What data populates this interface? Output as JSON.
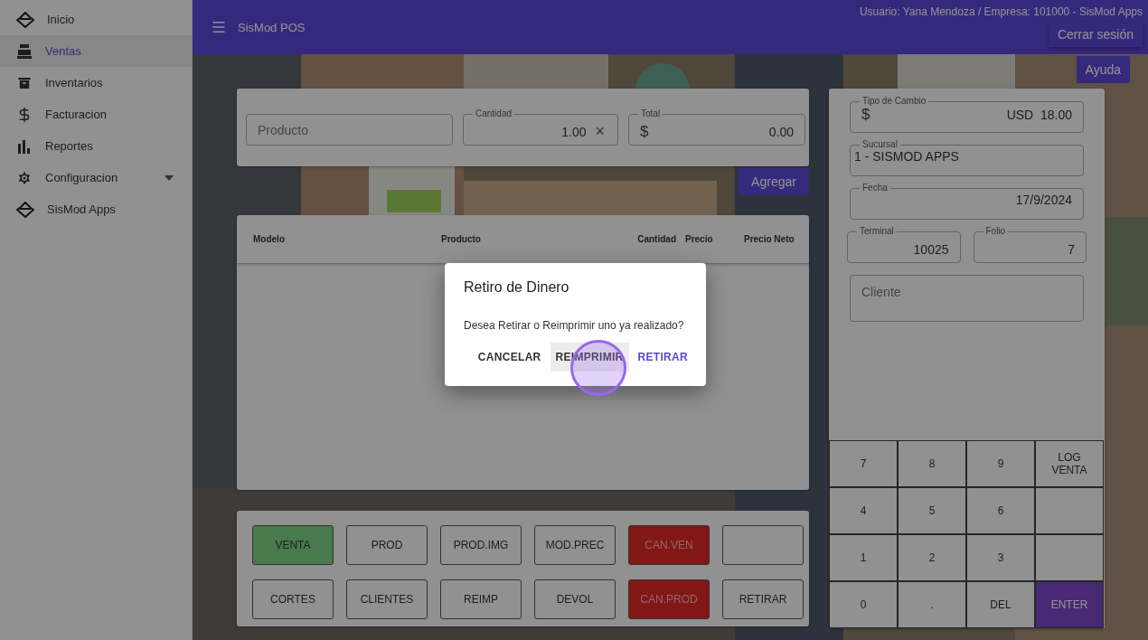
{
  "sidebar": {
    "items": [
      {
        "label": "Inicio",
        "selected": false
      },
      {
        "label": "Ventas",
        "selected": true
      },
      {
        "label": "Inventarios",
        "selected": false
      },
      {
        "label": "Facturacion",
        "selected": false
      },
      {
        "label": "Reportes",
        "selected": false
      },
      {
        "label": "Configuracion",
        "selected": false,
        "expanded": false
      },
      {
        "label": "SisMod Apps",
        "selected": false
      }
    ]
  },
  "topbar": {
    "title": "SisMod POS",
    "user": "Usuario: Yana Mendoza / Empresa: 101000 - SisMod Apps",
    "logout": "Cerrar sesión"
  },
  "help_button": "Ayuda",
  "entry": {
    "product": {
      "placeholder": "Producto"
    },
    "quantity": {
      "label": "Cantidad",
      "value": "1.00",
      "clear": "×"
    },
    "total": {
      "label": "Total",
      "prefix": "$",
      "value": "0.00"
    },
    "add_button": "Agregar"
  },
  "table": {
    "columns": [
      "Modelo",
      "Producto",
      "Cantidad",
      "Precio",
      "Precio Neto"
    ]
  },
  "form": {
    "exchange": {
      "label": "Tipo de Cambio",
      "prefix": "$",
      "value": "USD  18.00"
    },
    "branch": {
      "label": "Sucursal",
      "value": "1 - SISMOD APPS"
    },
    "date": {
      "label": "Fecha",
      "value": "17/9/2024"
    },
    "terminal": {
      "label": "Terminal",
      "value": "10025"
    },
    "folio": {
      "label": "Folio",
      "value": "7"
    },
    "client": {
      "placeholder": "Cliente"
    }
  },
  "actions": [
    {
      "label": "VENTA",
      "kind": "success"
    },
    {
      "label": "PROD",
      "kind": "plain"
    },
    {
      "label": "PROD.IMG",
      "kind": "plain"
    },
    {
      "label": "MOD.PREC",
      "kind": "plain"
    },
    {
      "label": "CAN.VEN",
      "kind": "danger"
    },
    {
      "kind": "plain"
    },
    {
      "label": "CORTES",
      "kind": "plain"
    },
    {
      "label": "CLIENTES",
      "kind": "plain"
    },
    {
      "label": "REIMP",
      "kind": "plain"
    },
    {
      "label": "DEVOL",
      "kind": "plain"
    },
    {
      "label": "CAN.PROD",
      "kind": "danger"
    },
    {
      "label": "RETIRAR",
      "kind": "plain"
    }
  ],
  "keypad": [
    {
      "label": "7",
      "kind": "plain"
    },
    {
      "label": "8",
      "kind": "plain"
    },
    {
      "label": "9",
      "kind": "plain"
    },
    {
      "label": "LOG VENTA",
      "kind": "plain"
    },
    {
      "label": "4",
      "kind": "plain"
    },
    {
      "label": "5",
      "kind": "plain"
    },
    {
      "label": "6",
      "kind": "plain"
    },
    {
      "kind": "plain"
    },
    {
      "label": "1",
      "kind": "plain"
    },
    {
      "label": "2",
      "kind": "plain"
    },
    {
      "label": "3",
      "kind": "plain"
    },
    {
      "kind": "plain"
    },
    {
      "label": "0",
      "kind": "plain"
    },
    {
      "label": ".",
      "kind": "plain"
    },
    {
      "label": "DEL",
      "kind": "plain"
    },
    {
      "label": "ENTER",
      "kind": "primary"
    }
  ],
  "dialog": {
    "title": "Retiro de Dinero",
    "message": "Desea Retirar o Reimprimir uno ya realizado?",
    "buttons": [
      {
        "label": "CANCELAR",
        "kind": "text",
        "highlighted": false
      },
      {
        "label": "REIMPRIMIR",
        "kind": "text",
        "highlighted": true
      },
      {
        "label": "RETIRAR",
        "kind": "primary",
        "highlighted": false
      }
    ]
  }
}
